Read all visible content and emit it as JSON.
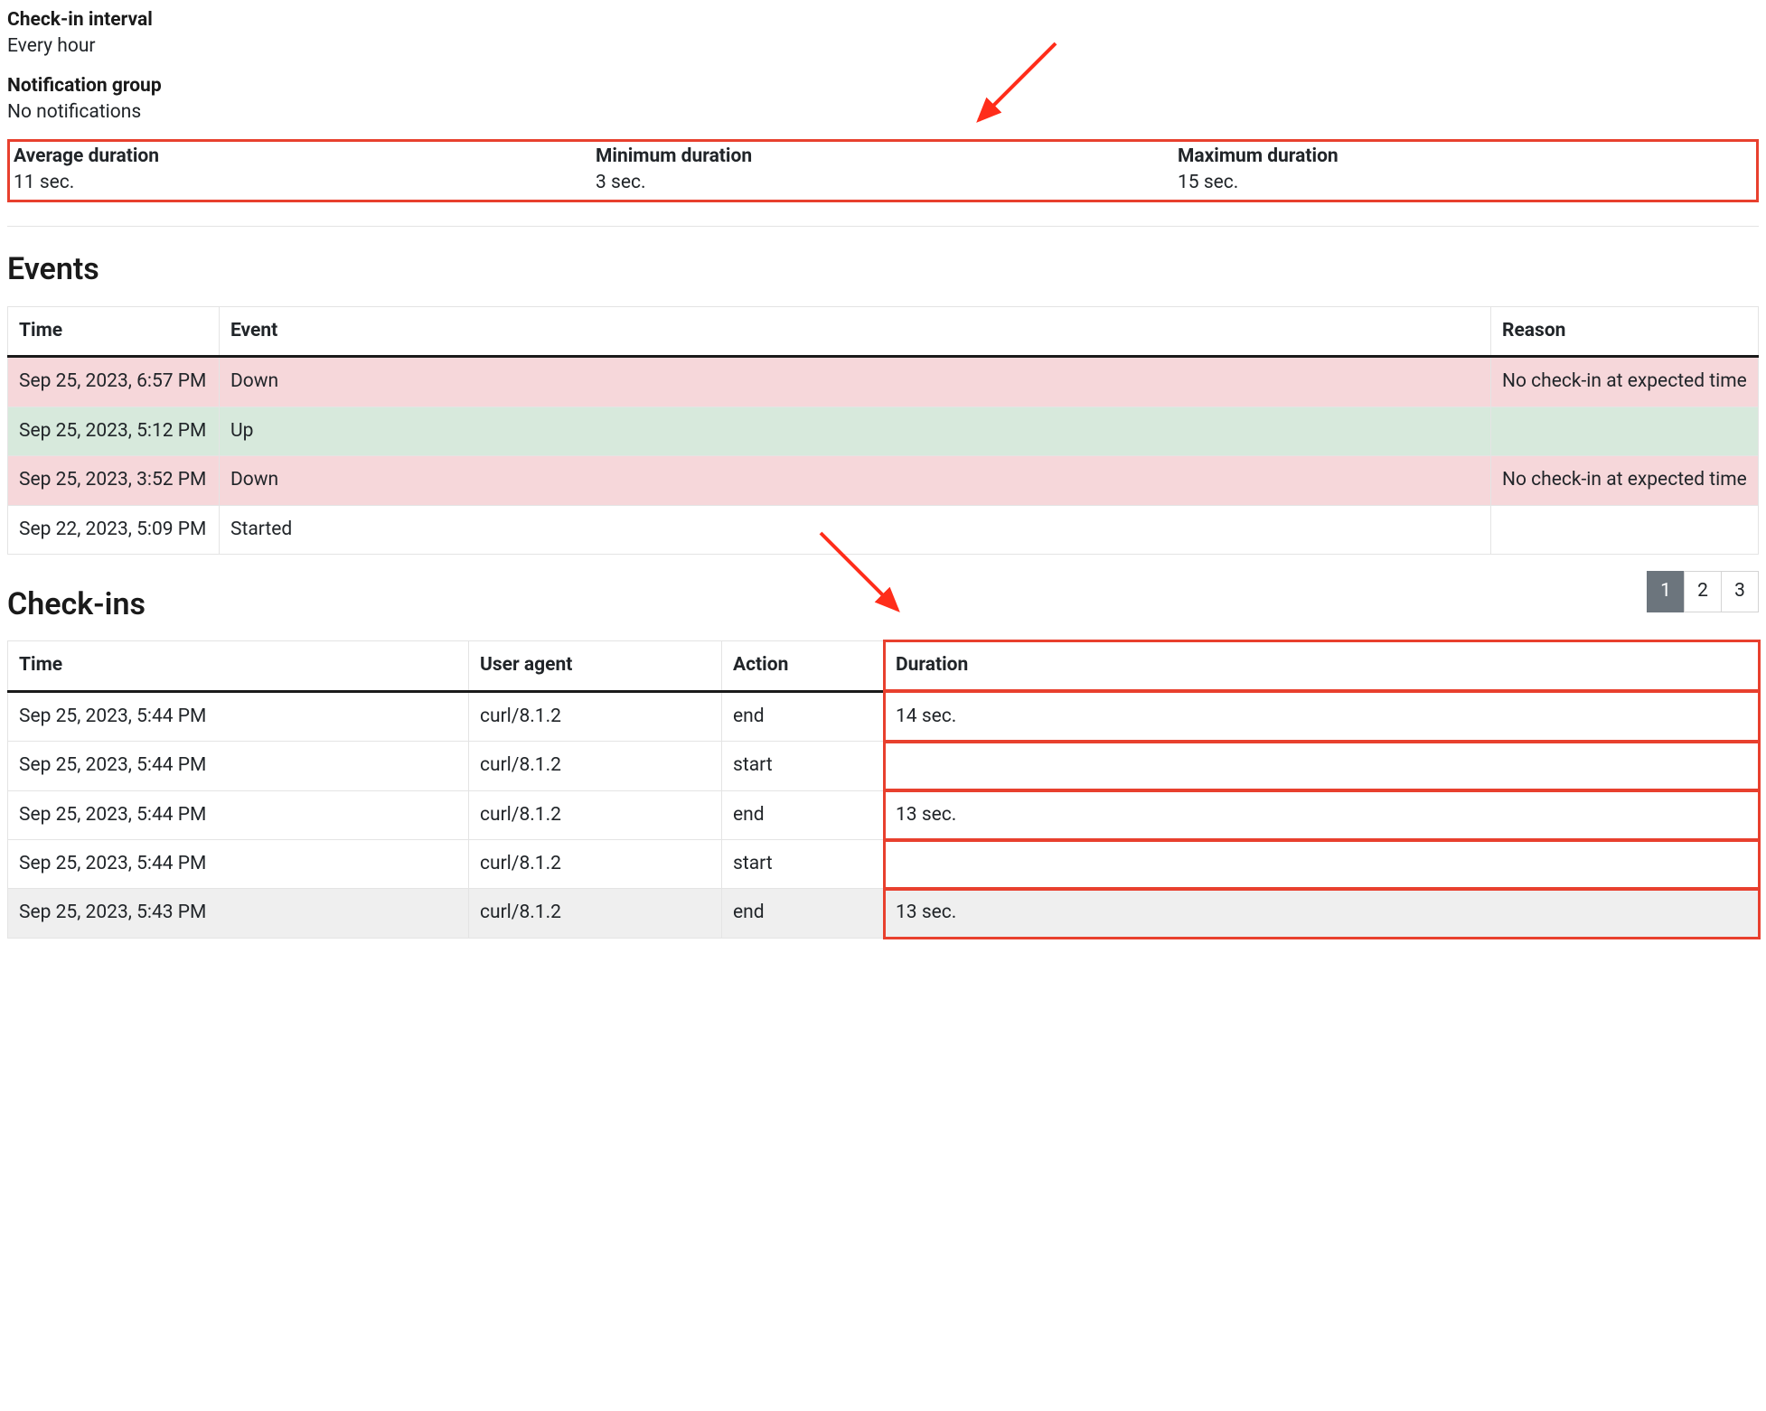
{
  "meta": {
    "checkin_interval_label": "Check-in interval",
    "checkin_interval_value": "Every hour",
    "notification_group_label": "Notification group",
    "notification_group_value": "No notifications"
  },
  "stats": {
    "avg_label": "Average duration",
    "avg_value": "11 sec.",
    "min_label": "Minimum duration",
    "min_value": "3 sec.",
    "max_label": "Maximum duration",
    "max_value": "15 sec."
  },
  "events": {
    "title": "Events",
    "headers": {
      "time": "Time",
      "event": "Event",
      "reason": "Reason"
    },
    "rows": [
      {
        "time": "Sep 25, 2023, 6:57 PM",
        "event": "Down",
        "reason": "No check-in at expected time",
        "status": "down"
      },
      {
        "time": "Sep 25, 2023, 5:12 PM",
        "event": "Up",
        "reason": "",
        "status": "up"
      },
      {
        "time": "Sep 25, 2023, 3:52 PM",
        "event": "Down",
        "reason": "No check-in at expected time",
        "status": "down"
      },
      {
        "time": "Sep 22, 2023, 5:09 PM",
        "event": "Started",
        "reason": "",
        "status": "neutral"
      }
    ]
  },
  "checkins": {
    "title": "Check-ins",
    "pages": [
      "1",
      "2",
      "3"
    ],
    "active_page": "1",
    "headers": {
      "time": "Time",
      "ua": "User agent",
      "action": "Action",
      "duration": "Duration"
    },
    "rows": [
      {
        "time": "Sep 25, 2023, 5:44 PM",
        "ua": "curl/8.1.2",
        "action": "end",
        "duration": "14 sec.",
        "alt": false
      },
      {
        "time": "Sep 25, 2023, 5:44 PM",
        "ua": "curl/8.1.2",
        "action": "start",
        "duration": "",
        "alt": false
      },
      {
        "time": "Sep 25, 2023, 5:44 PM",
        "ua": "curl/8.1.2",
        "action": "end",
        "duration": "13 sec.",
        "alt": false
      },
      {
        "time": "Sep 25, 2023, 5:44 PM",
        "ua": "curl/8.1.2",
        "action": "start",
        "duration": "",
        "alt": false
      },
      {
        "time": "Sep 25, 2023, 5:43 PM",
        "ua": "curl/8.1.2",
        "action": "end",
        "duration": "13 sec.",
        "alt": true
      }
    ]
  }
}
